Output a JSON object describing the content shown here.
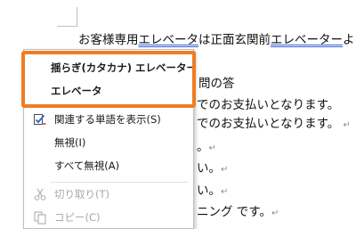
{
  "document": {
    "line1_before": "お客様専用",
    "line1_flag1": "エレベータ",
    "line1_middle": "は正面玄関前",
    "line1_flag2": "エレベーター",
    "line1_after": "よ",
    "line2": "問の答",
    "line3": "でのお支払いとなります。",
    "line4": "でのお支払いとなります。",
    "line5": "。",
    "line6": "い。",
    "line7": "い。",
    "line8": "。",
    "line9": "ニング",
    "line9_after": "です。",
    "para_mark": "↵"
  },
  "context_menu": {
    "suggestions": [
      {
        "label": "揺らぎ(カタカナ)  エレベーター"
      },
      {
        "label": "エレベータ"
      }
    ],
    "items": [
      {
        "label": "関連する単語を表示(S)",
        "icon": "checklist-icon",
        "enabled": true
      },
      {
        "label": "無視(I)",
        "enabled": true
      },
      {
        "label": "すべて無視(A)",
        "enabled": true
      },
      {
        "label": "切り取り(T)",
        "icon": "scissors-icon",
        "enabled": false
      },
      {
        "label": "コピー(C)",
        "icon": "copy-icon",
        "enabled": false
      }
    ]
  },
  "colors": {
    "highlight_border": "#ef7d22",
    "flag_underline": "#3a5fd6",
    "checklist_icon_blue": "#2f6fd1",
    "checklist_icon_red": "#d13438"
  }
}
